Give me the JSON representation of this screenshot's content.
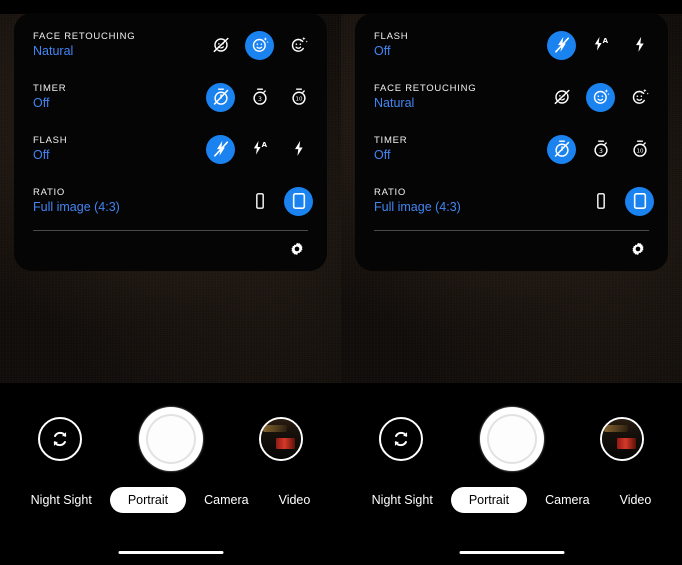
{
  "accent_blue": "#1a83f0",
  "value_text_blue": "#4285f4",
  "panel_background": "#050505",
  "screen_background": "#000000",
  "phones": [
    {
      "name": "left-phone",
      "settings_rows": [
        {
          "key": "face-retouching",
          "title": "FACE RETOUCHING",
          "value": "Natural",
          "options": [
            {
              "icon": "face-retouch-off-icon",
              "label": "Off",
              "selected": false
            },
            {
              "icon": "face-retouch-natural-icon",
              "label": "Natural",
              "selected": true
            },
            {
              "icon": "face-retouch-soft-icon",
              "label": "Soft",
              "selected": false
            }
          ]
        },
        {
          "key": "timer",
          "title": "TIMER",
          "value": "Off",
          "options": [
            {
              "icon": "timer-off-icon",
              "label": "Off",
              "selected": true
            },
            {
              "icon": "timer-3s-icon",
              "label": "3",
              "selected": false
            },
            {
              "icon": "timer-10s-icon",
              "label": "10",
              "selected": false
            }
          ]
        },
        {
          "key": "flash",
          "title": "FLASH",
          "value": "Off",
          "options": [
            {
              "icon": "flash-off-icon",
              "label": "Off",
              "selected": true
            },
            {
              "icon": "flash-auto-icon",
              "label": "Auto",
              "selected": false
            },
            {
              "icon": "flash-on-icon",
              "label": "On",
              "selected": false
            }
          ]
        },
        {
          "key": "ratio",
          "title": "RATIO",
          "value": "Full image (4:3)",
          "options": [
            {
              "icon": "ratio-16-9-icon",
              "label": "16:9",
              "selected": false
            },
            {
              "icon": "ratio-4-3-icon",
              "label": "4:3",
              "selected": true
            }
          ]
        }
      ],
      "more_settings_icon": "gear-icon",
      "bottom": {
        "flip_icon": "camera-flip-icon",
        "shutter_name": "shutter-button",
        "thumbnail_name": "gallery-thumbnail",
        "modes": [
          {
            "label": "Night Sight",
            "active": false
          },
          {
            "label": "Portrait",
            "active": true
          },
          {
            "label": "Camera",
            "active": false
          },
          {
            "label": "Video",
            "active": false
          }
        ]
      }
    },
    {
      "name": "right-phone",
      "settings_rows": [
        {
          "key": "flash",
          "title": "FLASH",
          "value": "Off",
          "options": [
            {
              "icon": "flash-off-icon",
              "label": "Off",
              "selected": true
            },
            {
              "icon": "flash-auto-icon",
              "label": "Auto",
              "selected": false
            },
            {
              "icon": "flash-on-icon",
              "label": "On",
              "selected": false
            }
          ]
        },
        {
          "key": "face-retouching",
          "title": "FACE RETOUCHING",
          "value": "Natural",
          "options": [
            {
              "icon": "face-retouch-off-icon",
              "label": "Off",
              "selected": false
            },
            {
              "icon": "face-retouch-natural-icon",
              "label": "Natural",
              "selected": true
            },
            {
              "icon": "face-retouch-soft-icon",
              "label": "Soft",
              "selected": false
            }
          ]
        },
        {
          "key": "timer",
          "title": "TIMER",
          "value": "Off",
          "options": [
            {
              "icon": "timer-off-icon",
              "label": "Off",
              "selected": true
            },
            {
              "icon": "timer-3s-icon",
              "label": "3",
              "selected": false
            },
            {
              "icon": "timer-10s-icon",
              "label": "10",
              "selected": false
            }
          ]
        },
        {
          "key": "ratio",
          "title": "RATIO",
          "value": "Full image (4:3)",
          "options": [
            {
              "icon": "ratio-16-9-icon",
              "label": "16:9",
              "selected": false
            },
            {
              "icon": "ratio-4-3-icon",
              "label": "4:3",
              "selected": true
            }
          ]
        }
      ],
      "more_settings_icon": "gear-icon",
      "bottom": {
        "flip_icon": "camera-flip-icon",
        "shutter_name": "shutter-button",
        "thumbnail_name": "gallery-thumbnail",
        "modes": [
          {
            "label": "Night Sight",
            "active": false
          },
          {
            "label": "Portrait",
            "active": true
          },
          {
            "label": "Camera",
            "active": false
          },
          {
            "label": "Video",
            "active": false
          }
        ]
      }
    }
  ]
}
